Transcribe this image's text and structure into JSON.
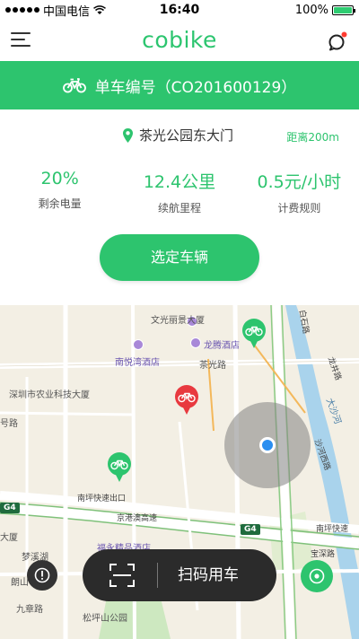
{
  "status_bar": {
    "carrier": "中国电信",
    "time": "16:40",
    "battery": "100%",
    "battery_level": 1.0
  },
  "nav": {
    "logo": "cobike",
    "menu_icon": "hamburger-menu-icon",
    "chat_icon": "message-icon",
    "notification_color": "#ff3b30"
  },
  "banner": {
    "title": "单车编号（CO201600129）",
    "icon": "bicycle-icon"
  },
  "location": {
    "name": "茶光公园东大门",
    "distance": "距离200m"
  },
  "stats": [
    {
      "value": "20%",
      "label": "剩余电量"
    },
    {
      "value": "12.4公里",
      "label": "续航里程"
    },
    {
      "value": "0.5元/小时",
      "label": "计费规则"
    }
  ],
  "select_button": "选定车辆",
  "map": {
    "labels": [
      {
        "text": "文光丽景大厦",
        "kind": "poi"
      },
      {
        "text": "龙腾酒店",
        "kind": "poi"
      },
      {
        "text": "南悦湾酒店",
        "kind": "poi"
      },
      {
        "text": "茶光路",
        "kind": "road"
      },
      {
        "text": "深圳市农业科技大厦",
        "kind": "place"
      },
      {
        "text": "号路",
        "kind": "road"
      },
      {
        "text": "南坪快速出口",
        "kind": "road"
      },
      {
        "text": "京港澳高速",
        "kind": "road"
      },
      {
        "text": "南坪快速",
        "kind": "road"
      },
      {
        "text": "沙河西路",
        "kind": "road"
      },
      {
        "text": "大沙河",
        "kind": "water"
      },
      {
        "text": "龙井路",
        "kind": "road"
      },
      {
        "text": "白石路",
        "kind": "road"
      },
      {
        "text": "梦溪湖",
        "kind": "place"
      },
      {
        "text": "朗山",
        "kind": "place"
      },
      {
        "text": "九章路",
        "kind": "road"
      },
      {
        "text": "松坪山公园",
        "kind": "place"
      },
      {
        "text": "宝深路",
        "kind": "road"
      },
      {
        "text": "大厦",
        "kind": "place"
      },
      {
        "text": "福永精品酒店",
        "kind": "poi"
      }
    ],
    "route_badges": [
      "G4",
      "G4"
    ],
    "bike_pin_colors": {
      "available": "#2dc46e",
      "selected": "#e8393f"
    }
  },
  "scan": {
    "label": "扫码用车",
    "icon": "scan-icon"
  },
  "buttons": {
    "report_icon": "exclamation-icon",
    "locate_icon": "locate-icon"
  }
}
